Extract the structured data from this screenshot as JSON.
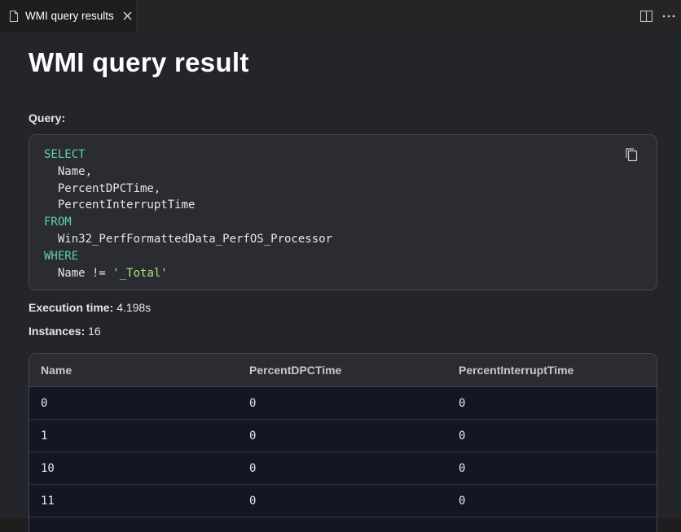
{
  "tab": {
    "label": "WMI query results",
    "close_glyph": "✕"
  },
  "icons": {
    "tab_icon": "file-icon",
    "split": "split-editor-icon",
    "more": "more-actions-icon",
    "copy": "copy-icon"
  },
  "page": {
    "title": "WMI query result"
  },
  "query": {
    "label": "Query:",
    "lines": [
      {
        "indent": "",
        "text": "SELECT",
        "kind": "keyword"
      },
      {
        "indent": "  ",
        "text": "Name,",
        "kind": "plain"
      },
      {
        "indent": "  ",
        "text": "PercentDPCTime,",
        "kind": "plain"
      },
      {
        "indent": "  ",
        "text": "PercentInterruptTime",
        "kind": "plain"
      },
      {
        "indent": "",
        "text": "FROM",
        "kind": "keyword"
      },
      {
        "indent": "  ",
        "text": "Win32_PerfFormattedData_PerfOS_Processor",
        "kind": "plain"
      },
      {
        "indent": "",
        "text": "WHERE",
        "kind": "keyword"
      },
      {
        "indent": "  ",
        "text": "Name != ",
        "kind": "plain",
        "string": "'_Total'"
      }
    ]
  },
  "execution": {
    "label": "Execution time:",
    "value": "4.198s"
  },
  "instances": {
    "label": "Instances:",
    "value": "16"
  },
  "table": {
    "columns": [
      "Name",
      "PercentDPCTime",
      "PercentInterruptTime"
    ],
    "rows": [
      [
        "0",
        "0",
        "0"
      ],
      [
        "1",
        "0",
        "0"
      ],
      [
        "10",
        "0",
        "0"
      ],
      [
        "11",
        "0",
        "0"
      ]
    ]
  },
  "colors": {
    "keyword": "#5fd0b4",
    "string": "#b5e07a",
    "background": "#23252b",
    "table_body": "#141623"
  }
}
